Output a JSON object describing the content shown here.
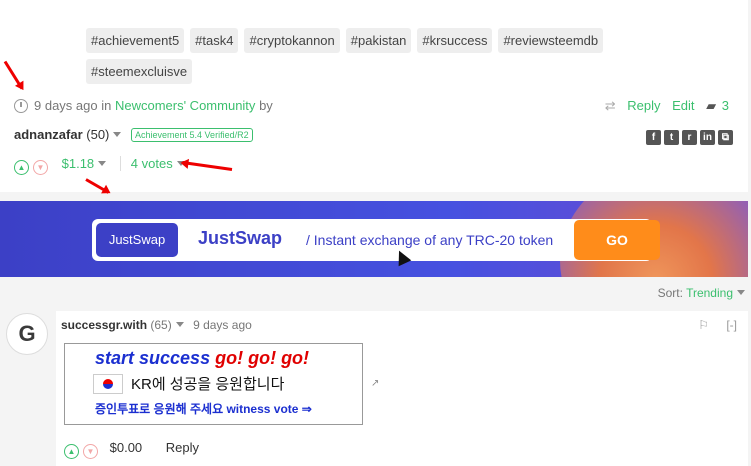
{
  "post": {
    "tags": [
      "#achievement5",
      "#task4",
      "#cryptokannon",
      "#pakistan",
      "#krsuccess",
      "#reviewsteemdb",
      "#steemexcluisve"
    ],
    "time": "9 days ago in",
    "community": "Newcomers' Community",
    "by": "by",
    "reply": "Reply",
    "edit": "Edit",
    "comment_count": "3",
    "author": "adnanzafar",
    "reputation": "(50)",
    "badge": "Achievement 5.4 Verified/R2",
    "payout": "$1.18",
    "votes": "4 votes"
  },
  "banner": {
    "logo": "JustSwap",
    "title": "JustSwap",
    "subtitle": "/ Instant exchange of any TRC-20 token",
    "go": "GO"
  },
  "sort": {
    "label": "Sort:",
    "value": "Trending"
  },
  "comment": {
    "author": "successgr.with",
    "reputation": "(65)",
    "time": "9 days ago",
    "collapse": "[-]",
    "image_line1": "start success",
    "image_line1_red": "go! go! go!",
    "image_line2": "KR에 성공을 응원합니다",
    "image_line3": "증인투표로 응원해 주세요 witness vote ⇒",
    "payout": "$0.00",
    "reply": "Reply"
  },
  "colors": {
    "accent": "#3bbf6e",
    "banner": "#3c40c6",
    "go": "#ff8c1a"
  }
}
